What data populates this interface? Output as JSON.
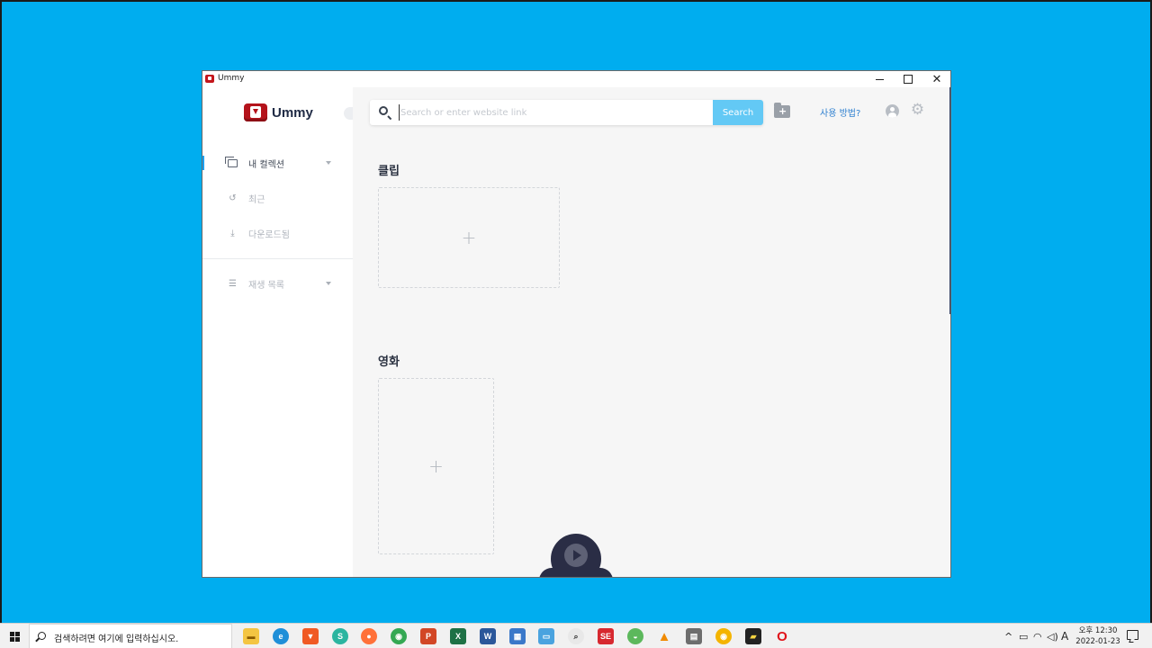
{
  "window": {
    "title": "Ummy"
  },
  "sidebar": {
    "brand": "Ummy",
    "items": [
      {
        "label": "내 컬렉션",
        "icon": "collection-icon",
        "expandable": true
      },
      {
        "label": "최근",
        "icon": "history-icon",
        "expandable": false
      },
      {
        "label": "다운로드됨",
        "icon": "download-icon",
        "expandable": false
      },
      {
        "label": "재생 목록",
        "icon": "playlist-icon",
        "expandable": true
      }
    ]
  },
  "header": {
    "search_placeholder": "Search or enter website link",
    "search_value": "",
    "search_button": "Search",
    "help_link": "사용 방법?"
  },
  "sections": [
    {
      "title": "클립",
      "tile_symbol": "+"
    },
    {
      "title": "영화",
      "tile_symbol": "+"
    }
  ],
  "taskbar": {
    "search_placeholder": "검색하려면 여기에 입력하십시오.",
    "apps": [
      "file-explorer-icon",
      "edge-icon",
      "brave-icon",
      "app-icon",
      "firefox-icon",
      "chrome-icon",
      "powerpoint-icon",
      "excel-icon",
      "word-icon",
      "app-icon",
      "remote-desktop-icon",
      "search-app-icon",
      "se-app-icon",
      "android-app-icon",
      "vlc-icon",
      "calculator-icon",
      "chrome-canary-icon",
      "sticky-notes-icon",
      "opera-icon"
    ],
    "ime": "A",
    "clock_time": "오후 12:30",
    "clock_date": "2022-01-23"
  },
  "colors": {
    "desktop": "#00adef",
    "accent": "#63c9f5",
    "brand_red": "#b4131b",
    "link": "#2f80d0"
  }
}
